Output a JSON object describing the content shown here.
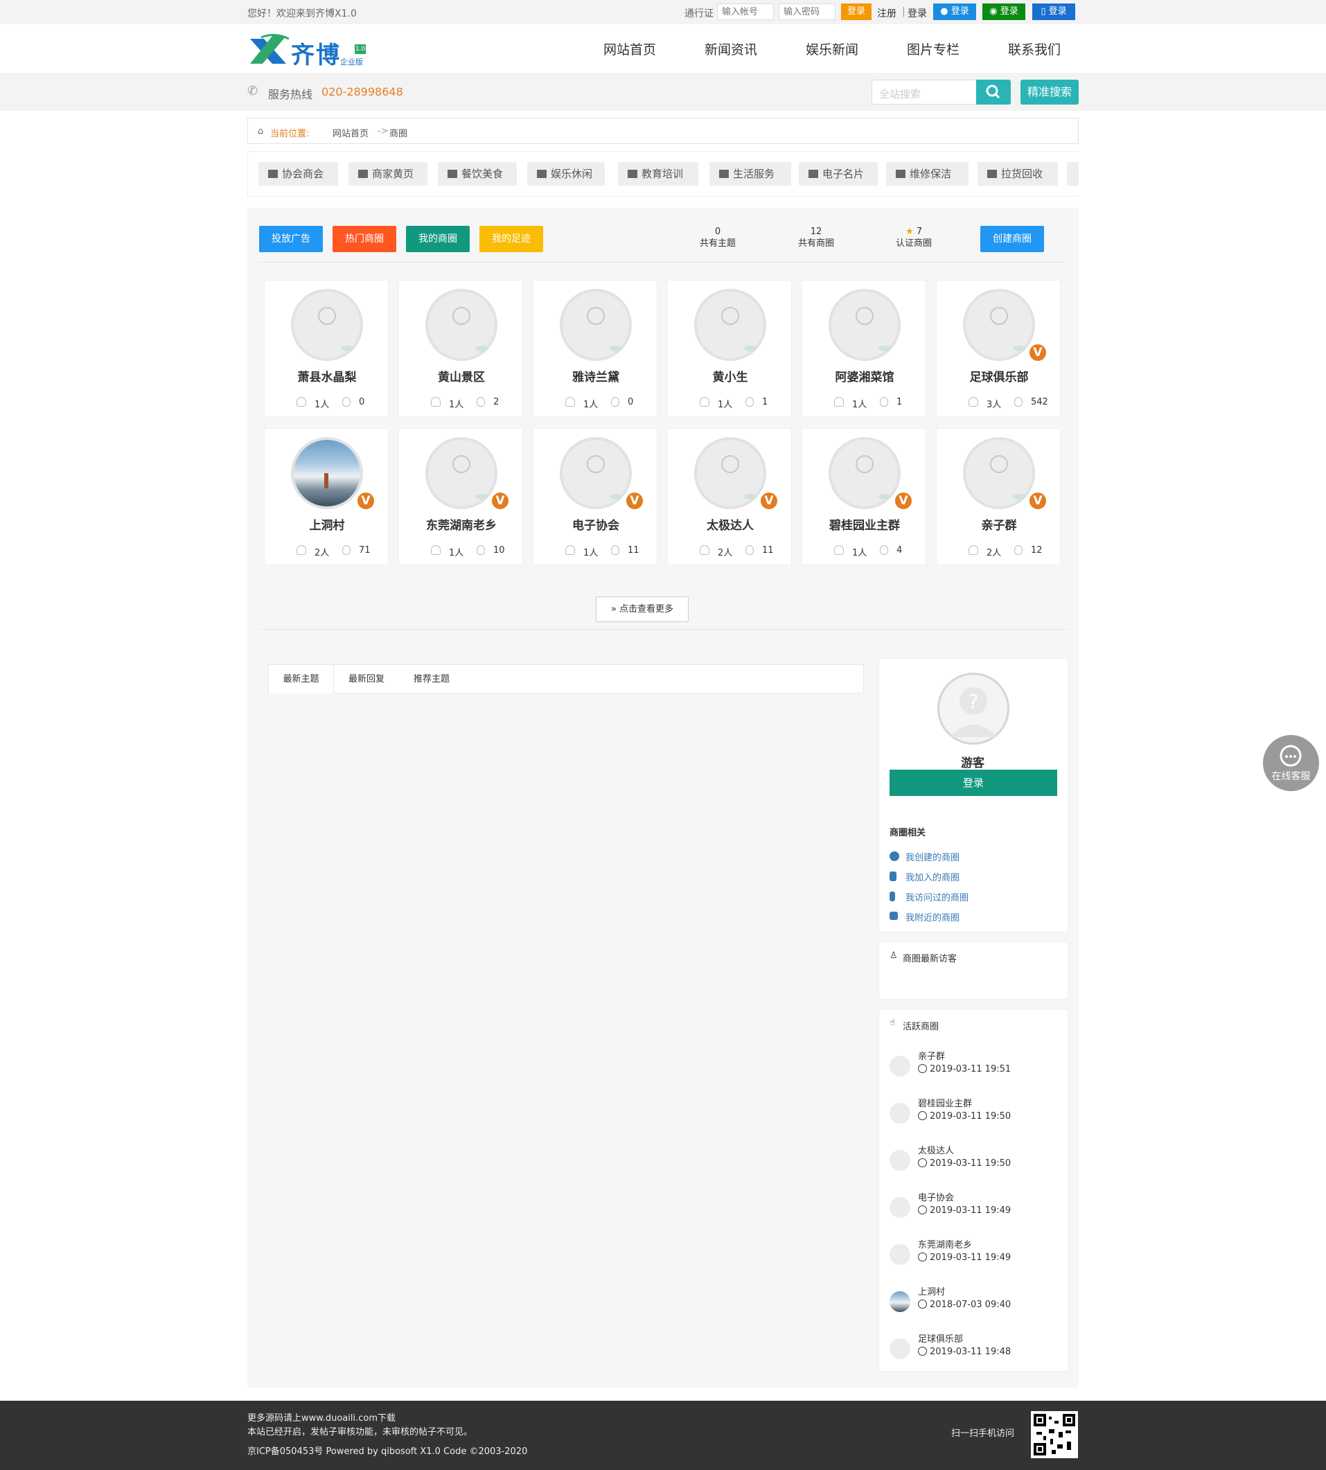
{
  "topbar": {
    "welcome": "您好！欢迎来到齐博X1.0",
    "pass_label": "通行证",
    "account_placeholder": "输入帐号",
    "password_placeholder": "输入密码",
    "login": "登录",
    "register": "注册",
    "login2": "登录",
    "qq_login": "登录",
    "wechat_login": "登录",
    "phone_login": "登录"
  },
  "header": {
    "logo_text": "齐博",
    "logo_version": "1.0",
    "logo_sub": "企业版",
    "nav": [
      "网站首页",
      "新闻资讯",
      "娱乐新闻",
      "图片专栏",
      "联系我们"
    ]
  },
  "hotline": {
    "label": "服务热线",
    "number": "020-28998648"
  },
  "search": {
    "placeholder": "全站搜索",
    "advanced": "精准搜索"
  },
  "breadcrumb": {
    "label": "当前位置:",
    "home": "网站首页",
    "sep": "->",
    "current": "商圈"
  },
  "categories": [
    "协会商会",
    "商家黄页",
    "餐饮美食",
    "娱乐休闲",
    "教育培训",
    "生活服务",
    "电子名片",
    "维修保洁",
    "拉货回收"
  ],
  "actions": {
    "ad": "投放广告",
    "hot": "热门商圈",
    "mine": "我的商圈",
    "footprint": "我的足迹",
    "create": "创建商圈"
  },
  "stats": [
    {
      "value": "0",
      "label": "共有主题"
    },
    {
      "value": "12",
      "label": "共有商圈"
    },
    {
      "value": "7",
      "label": "认证商圈"
    }
  ],
  "circles": [
    {
      "name": "萧县水晶梨",
      "members": "1人",
      "heat": "0",
      "verified": false
    },
    {
      "name": "黄山景区",
      "members": "1人",
      "heat": "2",
      "verified": false
    },
    {
      "name": "雅诗兰黛",
      "members": "1人",
      "heat": "0",
      "verified": false
    },
    {
      "name": "黄小生",
      "members": "1人",
      "heat": "1",
      "verified": false
    },
    {
      "name": "阿婆湘菜馆",
      "members": "1人",
      "heat": "1",
      "verified": false
    },
    {
      "name": "足球俱乐部",
      "members": "3人",
      "heat": "542",
      "verified": true
    },
    {
      "name": "上洞村",
      "members": "2人",
      "heat": "71",
      "verified": true
    },
    {
      "name": "东莞湖南老乡",
      "members": "1人",
      "heat": "10",
      "verified": true
    },
    {
      "name": "电子协会",
      "members": "1人",
      "heat": "11",
      "verified": true
    },
    {
      "name": "太极达人",
      "members": "2人",
      "heat": "11",
      "verified": true
    },
    {
      "name": "碧桂园业主群",
      "members": "1人",
      "heat": "4",
      "verified": true
    },
    {
      "name": "亲子群",
      "members": "2人",
      "heat": "12",
      "verified": true
    }
  ],
  "verified_badge": "V",
  "more_label": "点击查看更多",
  "tabs": [
    "最新主题",
    "最新回复",
    "推荐主题"
  ],
  "sidebar": {
    "guest": "游客",
    "login": "登录",
    "related_title": "商圈相关",
    "related_links": [
      "我创建的商圈",
      "我加入的商圈",
      "我访问过的商圈",
      "我附近的商圈"
    ],
    "visitors_title": "商圈最新访客",
    "active_title": "活跃商圈",
    "active": [
      {
        "name": "亲子群",
        "time": "2019-03-11 19:51"
      },
      {
        "name": "碧桂园业主群",
        "time": "2019-03-11 19:50"
      },
      {
        "name": "太极达人",
        "time": "2019-03-11 19:50"
      },
      {
        "name": "电子协会",
        "time": "2019-03-11 19:49"
      },
      {
        "name": "东莞湖南老乡",
        "time": "2019-03-11 19:49"
      },
      {
        "name": "上洞村",
        "time": "2018-07-03 09:40"
      },
      {
        "name": "足球俱乐部",
        "time": "2019-03-11 19:48"
      }
    ]
  },
  "kefu": "在线客服",
  "footer": {
    "line1": "更多源码请上www.duoaili.com下载",
    "line2": "本站已经开启，发帖子审核功能，未审核的帖子不可见。",
    "line3": "京ICP备050453号 Powered by qibosoft X1.0 Code ©2003-2020",
    "scan": "扫一扫手机访问"
  },
  "colors": {
    "teal": "#2ab4b6",
    "orange": "#f39800",
    "blue": "#2196f3",
    "green": "#12987f",
    "red_orange": "#ff5722",
    "yellow": "#fbbc05"
  }
}
